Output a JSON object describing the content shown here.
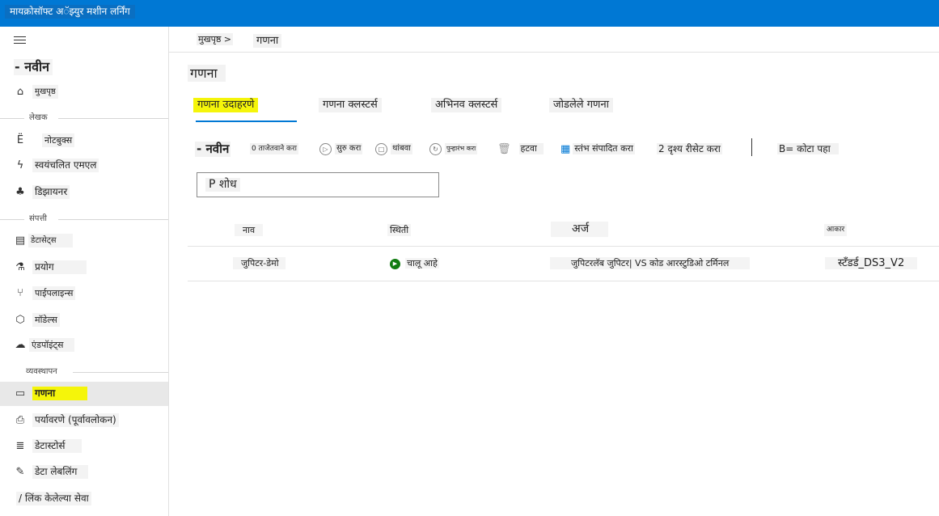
{
  "app": {
    "title": "मायक्रोसॉफ्ट अॅझ्युर मशीन लर्निंग"
  },
  "sidebar": {
    "new_label": "- नवीन",
    "home": "मुखपृष्ठ",
    "section_author": "लेखक",
    "notebooks": "नोटबुक्स",
    "automl": "स्वयंचलित एमएल",
    "designer": "डिझायनर",
    "section_assets": "संपत्ती",
    "datasets": "डेटासेट्स",
    "experiments": "प्रयोग",
    "pipelines": "पाईपलाइन्स",
    "models": "मॉडेल्स",
    "endpoints": "एंडपॉइंट्स",
    "section_manage": "व्यवस्थापन",
    "compute": "गणना",
    "environments": "पर्यावरणे (पूर्वावलोकन)",
    "datastores": "डेटास्टोर्स",
    "data_labeling": "डेटा लेबलिंग",
    "linked_services": "/ लिंक केलेल्या सेवा"
  },
  "breadcrumb": {
    "home": "मुखपृष्ठ >",
    "current": "गणना"
  },
  "page": {
    "title": "गणना"
  },
  "tabs": [
    "गणना उदाहरणे",
    "गणना क्लस्टर्स",
    "अभिनव क्लस्टर्स",
    "जोडलेले गणना"
  ],
  "toolbar": {
    "new": "- नवीन",
    "refresh": "0 ताजेतवाने करा",
    "start": "सुरु करा",
    "stop": "थांबवा",
    "restart": "पुन्हारंभ करा",
    "delete": "हटवा",
    "edit_columns": "स्तंभ संपादित करा",
    "reset_view": "2 दृश्य रीसेट करा",
    "quota": "B= कोटा पहा"
  },
  "search": {
    "placeholder": "P शोध"
  },
  "table": {
    "columns": [
      "नाव",
      "स्थिती",
      "अर्ज",
      "आकार"
    ],
    "rows": [
      {
        "name": "जुपिटर-डेमो",
        "status": "चालू आहे",
        "apps": "जुपिटरलॅब जुपिटर| VS कोड आरस्टुडिओ टर्मिनल",
        "size": "स्टँडर्ड_DS3_V2"
      }
    ]
  }
}
